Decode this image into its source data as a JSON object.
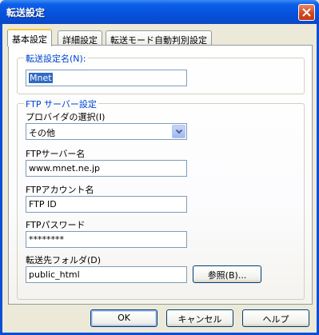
{
  "window": {
    "title": "転送設定"
  },
  "tabs": [
    {
      "label": "基本設定",
      "active": true
    },
    {
      "label": "詳細設定",
      "active": false
    },
    {
      "label": "転送モード自動判別設定",
      "active": false
    }
  ],
  "name_group": {
    "label": "転送設定名(N):",
    "value": "Mnet"
  },
  "ftp_group": {
    "label": "FTP サーバー設定",
    "provider_label": "プロバイダの選択(I)",
    "provider_value": "その他",
    "server_label": "FTPサーバー名",
    "server_value": "www.mnet.ne.jp",
    "account_label": "FTPアカウント名",
    "account_value": "FTP ID",
    "password_label": "FTPパスワード",
    "password_value": "********",
    "folder_label": "転送先フォルダ(D)",
    "folder_value": "public_html",
    "browse_label": "参照(B)..."
  },
  "buttons": {
    "ok": "OK",
    "cancel": "キャンセル",
    "help": "ヘルプ"
  },
  "colors": {
    "title_bar": "#0551dc",
    "group_label": "#0046d5",
    "selection": "#316ac5",
    "close_button": "#d2491f"
  }
}
